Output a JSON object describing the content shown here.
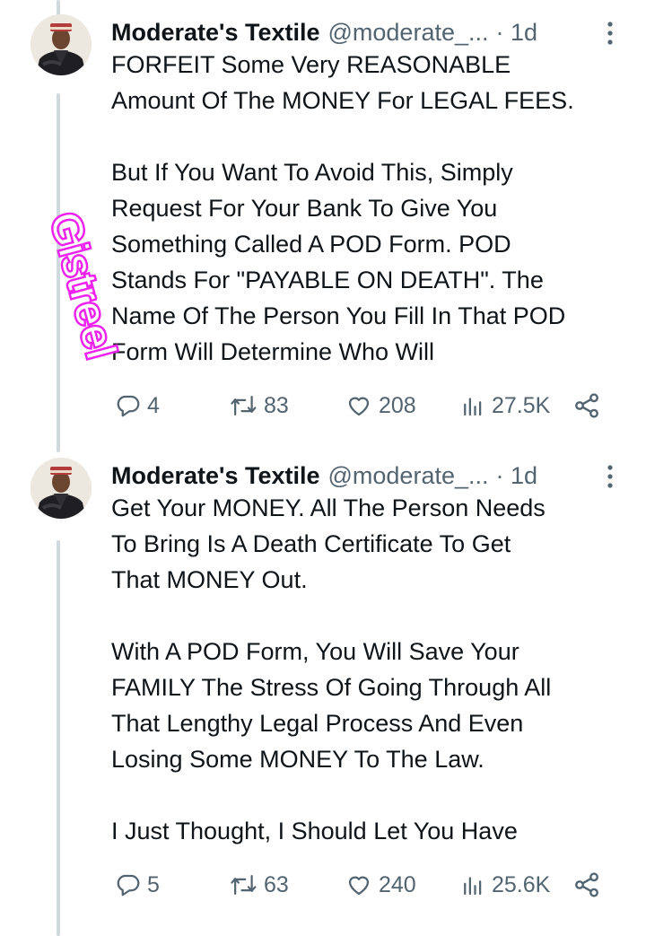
{
  "tweets": [
    {
      "author_name": "Moderate's Textile",
      "handle": "@moderate_...",
      "time": "· 1d",
      "body": "FORFEIT Some Very REASONABLE\nAmount Of The MONEY For LEGAL  FEES.\n\nBut If You Want To Avoid This, Simply\nRequest For Your Bank To Give You\nSomething Called A POD Form. POD\nStands For \"PAYABLE ON DEATH\". The\nName Of The Person You Fill In That POD\nForm Will Determine Who Will",
      "replies": "4",
      "reposts": "83",
      "likes": "208",
      "views": "27.5K"
    },
    {
      "author_name": "Moderate's Textile",
      "handle": "@moderate_...",
      "time": "· 1d",
      "body": "Get Your MONEY. All The Person Needs\nTo Bring Is A Death Certificate To Get\nThat MONEY Out.\n\nWith A POD Form, You Will Save Your\nFAMILY The Stress Of Going Through All\nThat Lengthy Legal Process And Even\nLosing Some MONEY To The Law.\n\nI Just Thought, I Should Let You Have",
      "replies": "5",
      "reposts": "63",
      "likes": "240",
      "views": "25.6K"
    }
  ],
  "watermark": {
    "text": "Gistreel",
    "color": "#ee22ee"
  },
  "icons": [
    "reply-icon",
    "repost-icon",
    "like-icon",
    "views-icon",
    "share-icon",
    "more-icon"
  ],
  "colors": {
    "text": "#0f1419",
    "secondary": "#536471",
    "thread_line": "#cfd9de"
  }
}
